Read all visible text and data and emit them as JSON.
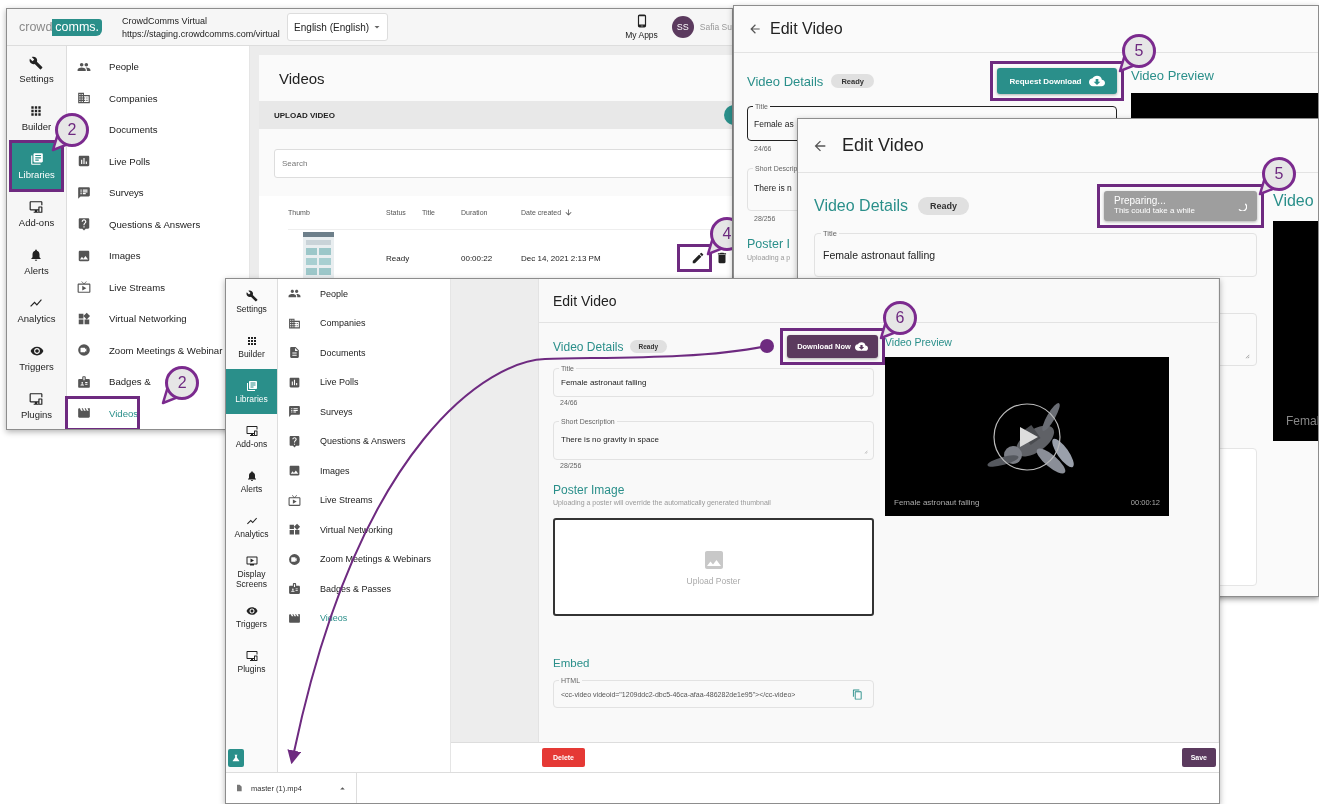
{
  "main_window": {
    "logo": [
      "crowd",
      "comms."
    ],
    "event_name": "CrowdComms Virtual",
    "event_url": "https://staging.crowdcomms.com/virtual",
    "language": "English (English)",
    "my_apps": "My Apps",
    "avatar": "SS",
    "user_name": "Safia Su",
    "rail": [
      {
        "label": "Settings",
        "selected": false
      },
      {
        "label": "Builder",
        "selected": false
      },
      {
        "label": "Libraries",
        "selected": true,
        "callout": "2"
      },
      {
        "label": "Add-ons",
        "selected": false
      },
      {
        "label": "Alerts",
        "selected": false
      },
      {
        "label": "Analytics",
        "selected": false
      },
      {
        "label": "Triggers",
        "selected": false
      },
      {
        "label": "Plugins",
        "selected": false
      }
    ],
    "menu": [
      {
        "label": "People",
        "selected": false,
        "icon_visible": true
      },
      {
        "label": "Companies",
        "selected": false,
        "icon_visible": true
      },
      {
        "label": "Documents",
        "selected": false,
        "icon_visible": false
      },
      {
        "label": "Live Polls",
        "selected": false,
        "icon_visible": true
      },
      {
        "label": "Surveys",
        "selected": false,
        "icon_visible": true
      },
      {
        "label": "Questions & Answers",
        "selected": false,
        "icon_visible": true
      },
      {
        "label": "Images",
        "selected": false,
        "icon_visible": true
      },
      {
        "label": "Live Streams",
        "selected": false,
        "icon_visible": true
      },
      {
        "label": "Virtual Networking",
        "selected": false,
        "icon_visible": true
      },
      {
        "label": "Zoom Meetings & Webinar",
        "selected": false,
        "icon_visible": true
      },
      {
        "label": "Badges &",
        "selected": false,
        "icon_visible": true
      },
      {
        "label": "Videos",
        "selected": true,
        "icon_visible": true,
        "callout": "2"
      }
    ],
    "page_title": "Videos",
    "upload_label": "UPLOAD VIDEO",
    "search_placeholder": "Search",
    "columns": [
      {
        "label": "Thumb",
        "sorted": false
      },
      {
        "label": "Status",
        "sorted": false
      },
      {
        "label": "Title",
        "sorted": false
      },
      {
        "label": "Duration",
        "sorted": false
      },
      {
        "label": "Date created",
        "sorted": true
      }
    ],
    "rows": [
      {
        "status": "Ready",
        "duration": "00:00:22",
        "date_created": "Dec 14, 2021 2:13 PM",
        "edit_callout": "4"
      }
    ]
  },
  "request_window": {
    "title": "Edit Video",
    "section_title": "Video Details",
    "status": "Ready",
    "download_button": {
      "label": "Request Download",
      "callout": "5"
    },
    "preview_title": "Video Preview",
    "fields": [
      {
        "label": "Title",
        "value": "Female as",
        "counter": "24/66",
        "focused": true
      },
      {
        "label": "Short Descrip",
        "value": "There is n",
        "counter": "28/256",
        "focused": false
      }
    ],
    "poster_title": "Poster I",
    "poster_hint": "Uploading a p"
  },
  "preparing_window": {
    "title": "Edit Video",
    "section_title": "Video Details",
    "status": "Ready",
    "preparing_button": {
      "label": "Preparing...",
      "sublabel": "This could take a while",
      "callout": "5"
    },
    "preview_title": "Video",
    "preview_caption": "Femal",
    "fields": [
      {
        "label": "Title",
        "value": "Female astronaut falling",
        "focused": false
      }
    ]
  },
  "detail_window": {
    "rail": [
      {
        "label": "Settings",
        "selected": false
      },
      {
        "label": "Builder",
        "selected": false
      },
      {
        "label": "Libraries",
        "selected": true
      },
      {
        "label": "Add-ons",
        "selected": false
      },
      {
        "label": "Alerts",
        "selected": false
      },
      {
        "label": "Analytics",
        "selected": false
      },
      {
        "label": "Display Screens",
        "selected": false
      },
      {
        "label": "Triggers",
        "selected": false
      },
      {
        "label": "Plugins",
        "selected": false
      }
    ],
    "menu": [
      {
        "label": "People",
        "selected": false
      },
      {
        "label": "Companies",
        "selected": false
      },
      {
        "label": "Documents",
        "selected": false
      },
      {
        "label": "Live Polls",
        "selected": false
      },
      {
        "label": "Surveys",
        "selected": false
      },
      {
        "label": "Questions & Answers",
        "selected": false
      },
      {
        "label": "Images",
        "selected": false
      },
      {
        "label": "Live Streams",
        "selected": false
      },
      {
        "label": "Virtual Networking",
        "selected": false
      },
      {
        "label": "Zoom Meetings & Webinars",
        "selected": false
      },
      {
        "label": "Badges & Passes",
        "selected": false
      },
      {
        "label": "Videos",
        "selected": true
      }
    ],
    "title": "Edit Video",
    "section_title": "Video Details",
    "status": "Ready",
    "download_button": {
      "label": "Download Now",
      "callout": "6"
    },
    "preview_title": "Video Preview",
    "preview": {
      "kind": "picture",
      "caption": "Female astronaut falling",
      "duration": "00:00:12"
    },
    "fields": [
      {
        "kind": "text",
        "label": "Title",
        "value": "Female astronaut falling",
        "counter": "24/66",
        "focused": false
      },
      {
        "kind": "textarea",
        "label": "Short Description",
        "value": "There is no gravity in space",
        "counter": "28/256",
        "focused": false
      }
    ],
    "poster_title": "Poster Image",
    "poster_hint": "Uploading a poster will override the automatically generated thumbnail",
    "upload_poster": "Upload Poster",
    "embed_title": "Embed",
    "embed_field": {
      "label": "HTML",
      "value": "<cc-video videoid=\"1209ddc2-dbc5-46ca-afaa-486282de1e95\"></cc-video>"
    },
    "delete_button": "Delete",
    "save_button": "Save",
    "download": {
      "file_name": "master (1).mp4"
    }
  }
}
